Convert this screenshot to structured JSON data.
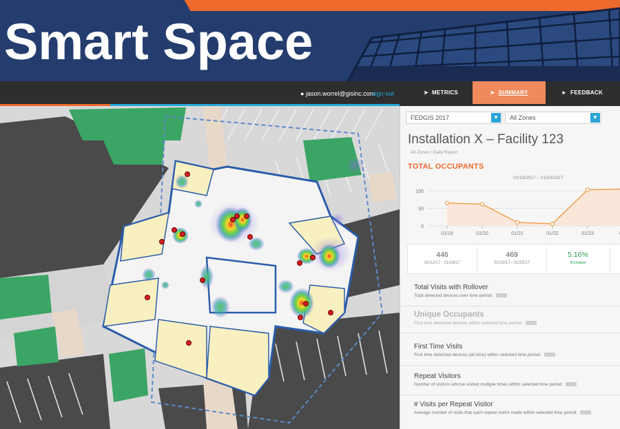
{
  "banner": {
    "title": "Smart Space"
  },
  "topnav": {
    "user": "jason.worrel@gisinc.com",
    "signout": "sign-out",
    "metrics": "METRICS",
    "summary": "SUMMARY",
    "feedback": "FEEDBACK"
  },
  "filters": {
    "facility_group": "FEDGIS 2017",
    "zone": "All Zones"
  },
  "facility": {
    "title": "Installation X – Facility 123",
    "crumb": "All Zones / Daily Report"
  },
  "occupants": {
    "heading": "TOTAL OCCUPANTS",
    "range": "01/18/2017 – 01/24/2017"
  },
  "chart_data": {
    "type": "line",
    "title": "",
    "categories": [
      "01/19",
      "01/20",
      "01/21",
      "01/22",
      "01/23",
      "01/"
    ],
    "values": [
      65,
      62,
      10,
      6,
      103,
      105
    ],
    "yticks": [
      0,
      50,
      100
    ],
    "ylim": [
      0,
      110
    ],
    "color": "#f0a050"
  },
  "stats": [
    {
      "value": "446",
      "sub": "01/12/17 - 01/18/17"
    },
    {
      "value": "469",
      "sub": "01/19/17 - 01/25/17"
    },
    {
      "value": "5.16%",
      "sub": "Increase"
    }
  ],
  "metrics": [
    {
      "title": "Total Visits with Rollover",
      "desc": "Total detected devices over time period."
    },
    {
      "title": "Unique Occupants",
      "desc": "First time detected devices within selected time period."
    },
    {
      "title": "First Time Visits",
      "desc": "First time detected devices (all-time) within selected time period."
    },
    {
      "title": "Repeat Visitors",
      "desc": "Number of visitors who've visited multiple times within selected time period."
    },
    {
      "title": "# Visits per Repeat Visitor",
      "desc": "Average number of visits that each repeat visitor made within selected time period."
    }
  ],
  "colors": {
    "banner_bg": "#243d6e",
    "banner_orange": "#ee6a2c",
    "nav_bg": "#2e2e2e",
    "active_tab": "#f08a5d",
    "link_blue": "#23a8d8",
    "increase_green": "#2c9e52",
    "building_outline": "#2a5ca8",
    "grass": "#3aa565"
  }
}
